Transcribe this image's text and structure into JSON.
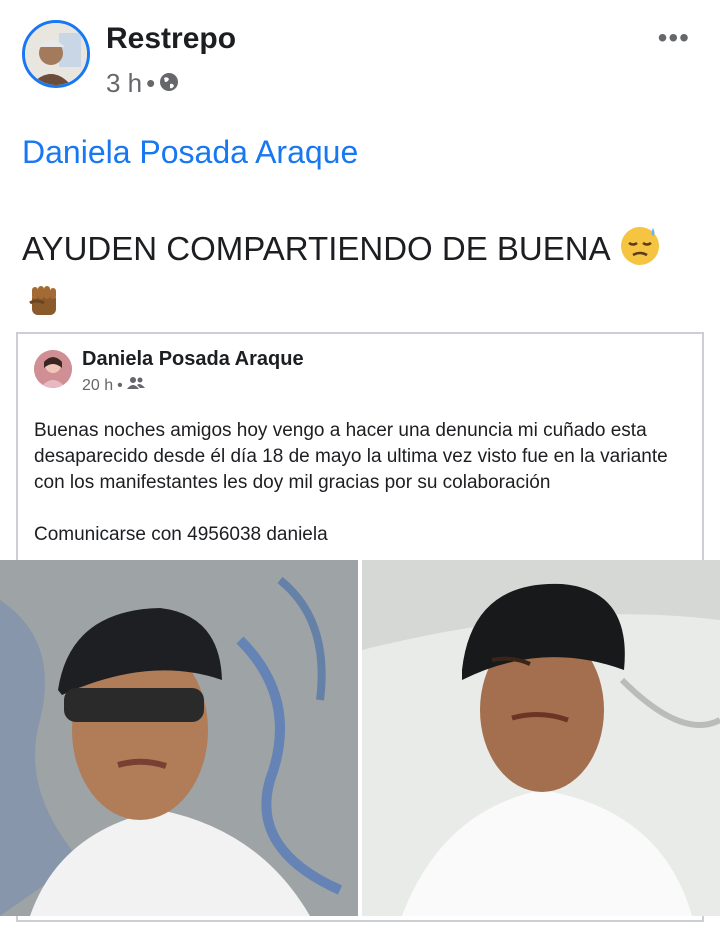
{
  "post": {
    "author": "Restrepo",
    "time": "3 h",
    "separator": "•",
    "more_label": "•••",
    "tagged_name": "Daniela Posada Araque",
    "text": "AYUDEN COMPARTIENDO DE BUENA"
  },
  "shared_post": {
    "author": "Daniela Posada Araque",
    "time": "20 h",
    "separator": "•",
    "text": "Buenas noches amigos hoy vengo a hacer una denuncia mi cuñado esta desaparecido desde él día 18 de mayo la ultima vez visto fue en la variante con los manifestantes les doy mil gracias por su colaboración",
    "contact": "Comunicarse con 4956038 daniela"
  },
  "icons": {
    "privacy": "globe-icon",
    "shared_privacy": "friends-icon",
    "emoji_1": "downcast-face-with-sweat-emoji",
    "emoji_2": "raised-fist-emoji"
  },
  "colors": {
    "link": "#1877f2",
    "meta": "#65676b",
    "text": "#1c1e21"
  }
}
